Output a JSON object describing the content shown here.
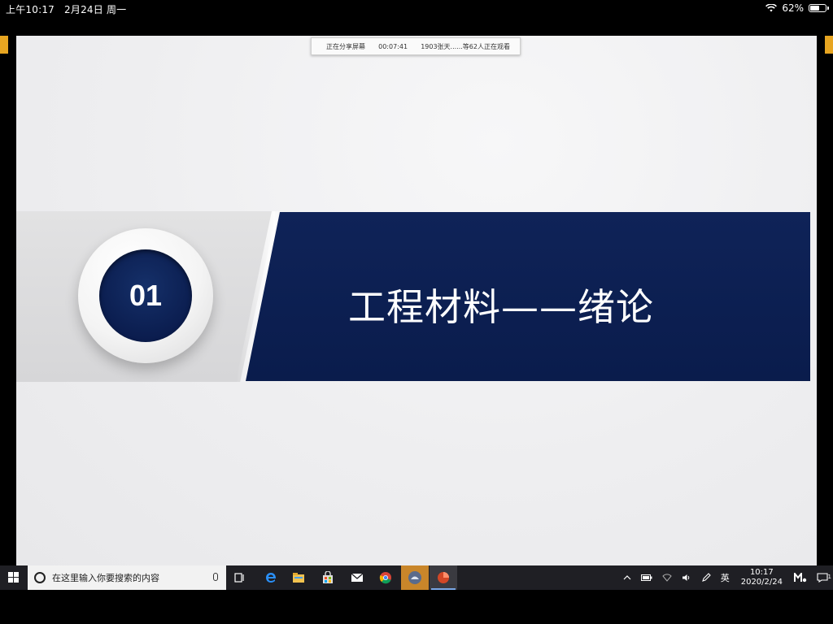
{
  "ios_status": {
    "time": "上午10:17",
    "date": "2月24日 周一",
    "battery_percent": "62%",
    "battery_level": 0.62
  },
  "share_bar": {
    "status": "正在分享屏幕",
    "timer": "00:07:41",
    "viewers": "1903张天......等62人正在观看"
  },
  "slide": {
    "number": "01",
    "title": "工程材料——绪论"
  },
  "taskbar": {
    "search_placeholder": "在这里输入你要搜索的内容",
    "tray_ime": "英",
    "clock_time": "10:17",
    "clock_date": "2020/2/24",
    "notification_count": "1"
  },
  "colors": {
    "navy": "#0b1d4f",
    "accent_orange": "#e7a521",
    "taskbar": "#1f1f24"
  }
}
